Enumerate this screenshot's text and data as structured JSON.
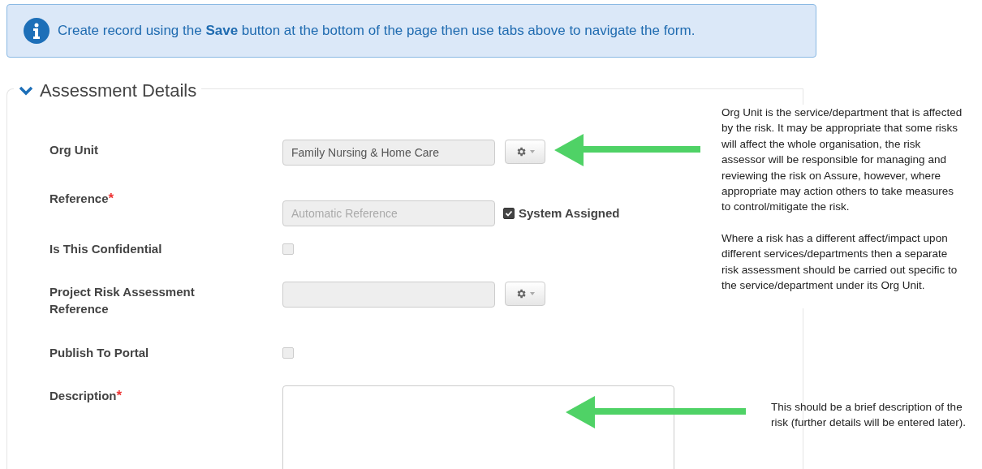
{
  "alert": {
    "text": "Create record using the **Save** button at the bottom of the page then use tabs above to navigate the form."
  },
  "section": {
    "title": "Assessment Details",
    "expanded": true
  },
  "fields": [
    {
      "kind": "select",
      "label": "Org Unit",
      "value": "Family Nursing & Home Care"
    },
    {
      "kind": "text",
      "label": "Reference",
      "required_mark": "*",
      "placeholder": "Automatic Reference",
      "option": {
        "label": "System Assigned",
        "checked": true
      }
    },
    {
      "kind": "checkbox",
      "label": "Is This Confidential",
      "checked": false
    },
    {
      "kind": "select",
      "label": "Project Risk Assessment Reference"
    },
    {
      "kind": "checkbox",
      "label": "Publish To Portal",
      "checked": false
    },
    {
      "kind": "textarea",
      "label": "Description",
      "required_mark": "*"
    }
  ],
  "notes": [
    {
      "paragraphs": [
        "Org Unit is the service/department that is affected by the risk. It may be appropriate that some risks will affect the whole organisation, the risk assessor will be responsible for managing and reviewing the risk on Assure, however, where appropriate may action others to take measures to control/mitigate the risk.",
        "Where a risk has a different affect/impact upon different services/departments then a separate risk assessment should be carried out specific to the service/department under its Org Unit."
      ]
    },
    {
      "paragraphs": [
        "This should be a brief description of the risk (further details will be entered later)."
      ]
    }
  ]
}
